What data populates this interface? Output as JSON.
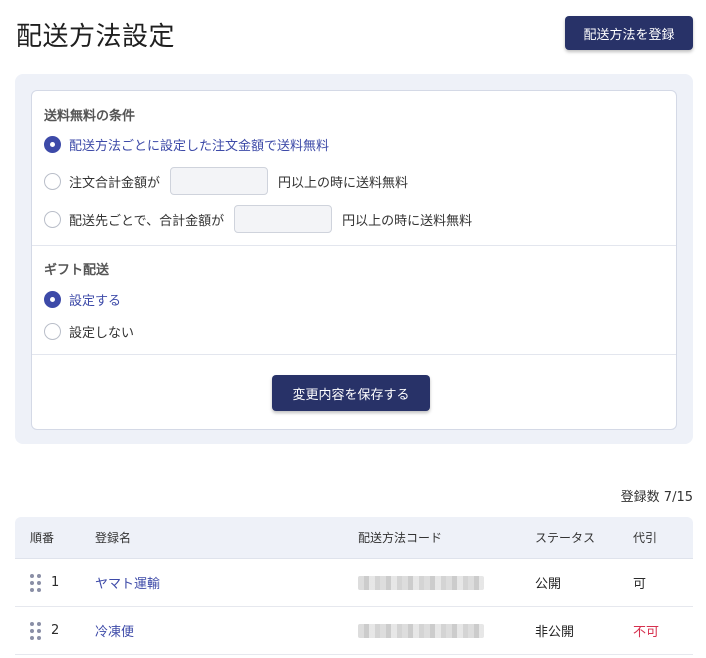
{
  "header": {
    "title": "配送方法設定",
    "register_label": "配送方法を登録"
  },
  "shipping_free": {
    "heading": "送料無料の条件",
    "options": [
      {
        "label": "配送方法ごとに設定した注文金額で送料無料",
        "selected": true
      },
      {
        "label": "注文合計金額が",
        "suffix": "円以上の時に送料無料",
        "input_value": "",
        "selected": false
      },
      {
        "label": "配送先ごとで、合計金額が",
        "suffix": "円以上の時に送料無料",
        "input_value": "",
        "selected": false
      }
    ]
  },
  "gift": {
    "heading": "ギフト配送",
    "options": [
      {
        "label": "設定する",
        "selected": true
      },
      {
        "label": "設定しない",
        "selected": false
      }
    ]
  },
  "save_label": "変更内容を保存する",
  "count": "登録数 7/15",
  "table": {
    "headers": [
      "順番",
      "登録名",
      "配送方法コード",
      "ステータス",
      "代引"
    ],
    "rows": [
      {
        "order": "1",
        "name": "ヤマト運輸",
        "status": "公開",
        "cod": "可"
      },
      {
        "order": "2",
        "name": "冷凍便",
        "status": "非公開",
        "cod": "不可"
      }
    ]
  },
  "colors": {
    "primary": "#283268",
    "accent": "#3d4aa8",
    "danger": "#d6304e",
    "panel_bg": "#eef1f8"
  },
  "icons": [
    "drag-handle-icon",
    "radio-checked-icon",
    "radio-unchecked-icon"
  ]
}
